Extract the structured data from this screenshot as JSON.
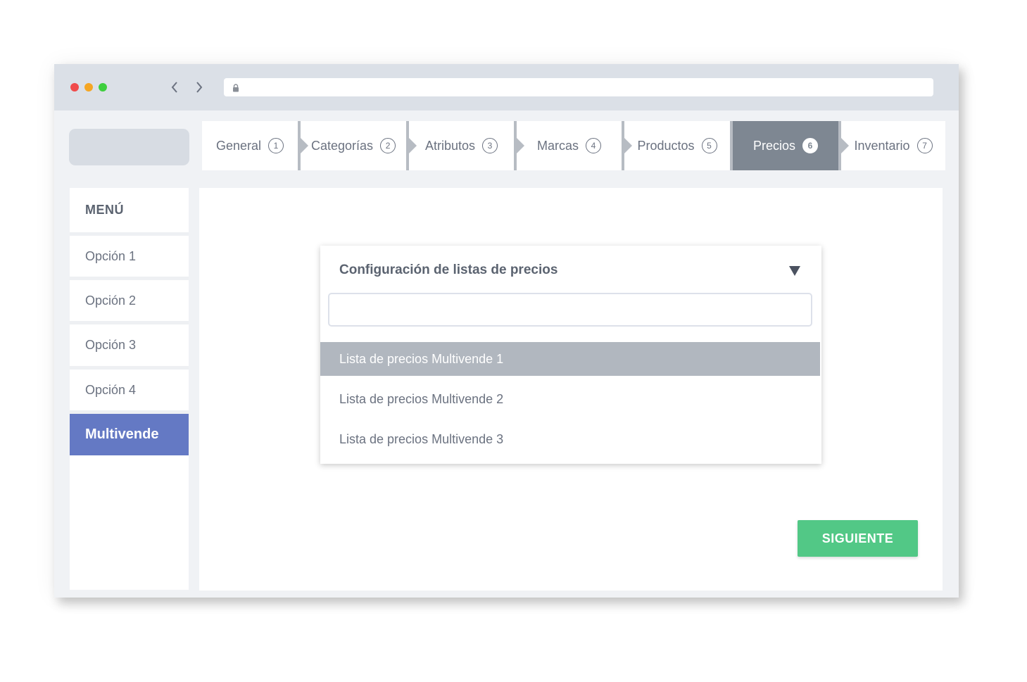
{
  "browser": {
    "dots": [
      {
        "name": "close",
        "color": "#f04b4b"
      },
      {
        "name": "minimize",
        "color": "#f5a623"
      },
      {
        "name": "maximize",
        "color": "#3ecf3e"
      }
    ],
    "back_icon": "chevron-left-icon",
    "forward_icon": "chevron-right-icon",
    "lock_icon": "lock-icon"
  },
  "stepper": {
    "steps": [
      {
        "label": "General",
        "num": "1"
      },
      {
        "label": "Categorías",
        "num": "2"
      },
      {
        "label": "Atributos",
        "num": "3"
      },
      {
        "label": "Marcas",
        "num": "4"
      },
      {
        "label": "Productos",
        "num": "5"
      },
      {
        "label": "Precios",
        "num": "6",
        "active": true
      },
      {
        "label": "Inventario",
        "num": "7"
      }
    ]
  },
  "sidebar": {
    "title": "MENÚ",
    "items": [
      {
        "label": "Opción 1"
      },
      {
        "label": "Opción 2"
      },
      {
        "label": "Opción 3"
      },
      {
        "label": "Opción 4"
      },
      {
        "label": "Multivende",
        "active": true
      }
    ],
    "active_color": "#6479c4"
  },
  "dropdown": {
    "title": "Configuración de listas de precios",
    "search_value": "",
    "options": [
      {
        "label": "Lista de precios Multivende 1",
        "selected": true
      },
      {
        "label": "Lista de precios Multivende 2"
      },
      {
        "label": "Lista de precios Multivende 3"
      }
    ]
  },
  "actions": {
    "next_label": "SIGUIENTE",
    "next_color": "#52c886"
  }
}
